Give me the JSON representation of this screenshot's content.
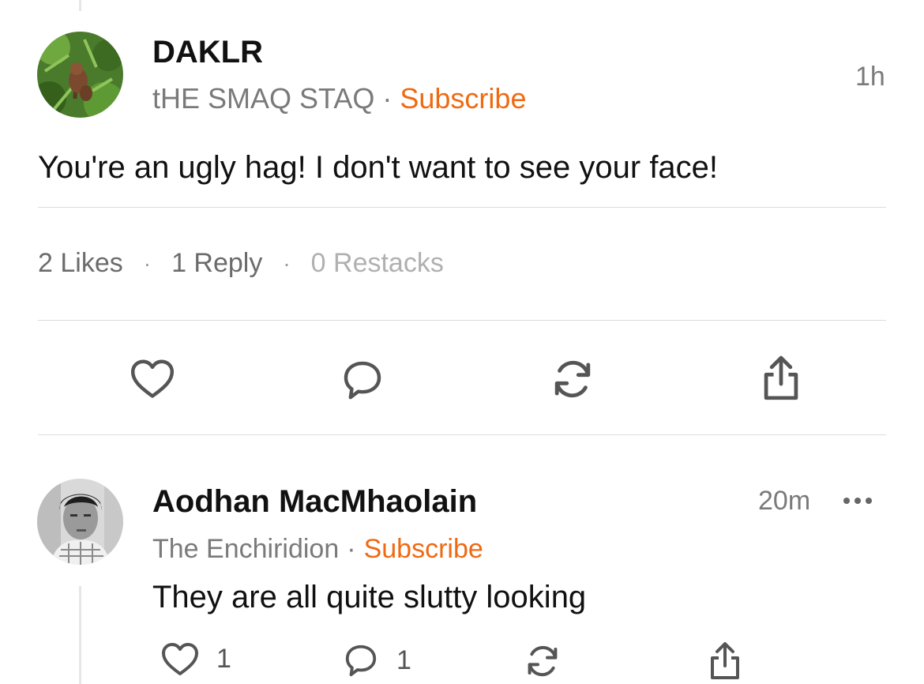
{
  "post": {
    "author": "DAKLR",
    "publication": "tHE SMAQ STAQ",
    "separator": "·",
    "subscribe_label": "Subscribe",
    "time": "1h",
    "body": "You're an ugly hag! I don't want to see your face!",
    "stats": {
      "likes": "2 Likes",
      "replies": "1 Reply",
      "restacks": "0 Restacks",
      "separator": "·"
    },
    "actions": {
      "like_icon": "heart-icon",
      "reply_icon": "comment-icon",
      "restack_icon": "restack-icon",
      "share_icon": "share-icon"
    }
  },
  "reply": {
    "author": "Aodhan MacMhaolain",
    "publication": "The Enchiridion",
    "separator": "·",
    "subscribe_label": "Subscribe",
    "time": "20m",
    "more_icon": "more-horizontal-icon",
    "body": "They are all quite slutty looking",
    "like_count": "1",
    "reply_count": "1"
  },
  "colors": {
    "accent": "#ef6a12",
    "text": "#111111",
    "muted": "#7a7a7a",
    "divider": "#dcdcdc"
  }
}
